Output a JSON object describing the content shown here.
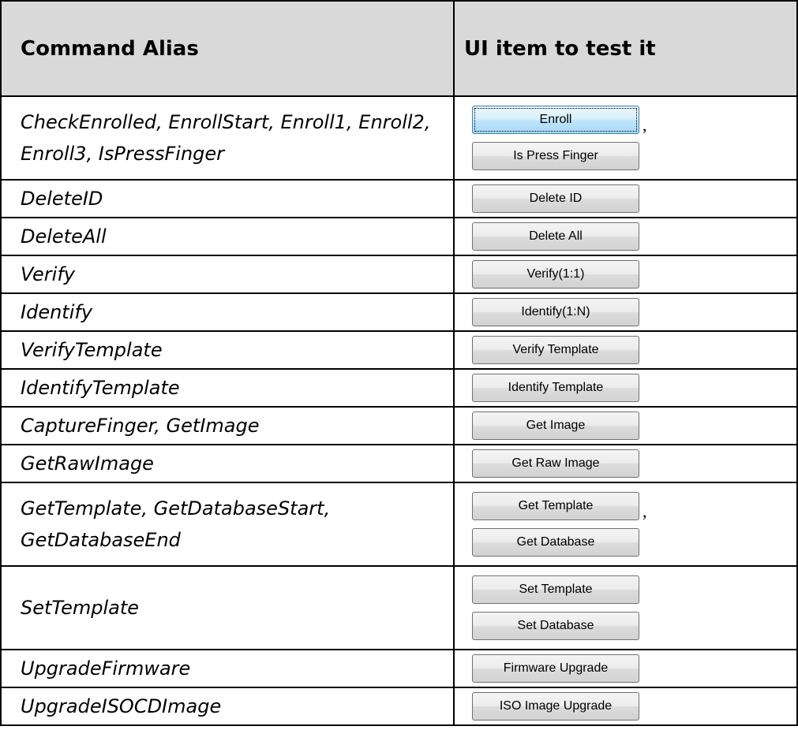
{
  "header": {
    "col1": "Command Alias",
    "col2": "UI item to test it"
  },
  "rows": [
    {
      "alias": "CheckEnrolled, EnrollStart, Enroll1, Enroll2, Enroll3, IsPressFinger",
      "buttons": [
        "Enroll",
        "Is Press Finger"
      ],
      "separator": ","
    },
    {
      "alias": "DeleteID",
      "buttons": [
        "Delete ID"
      ]
    },
    {
      "alias": "DeleteAll",
      "buttons": [
        "Delete All"
      ]
    },
    {
      "alias": "Verify",
      "buttons": [
        "Verify(1:1)"
      ]
    },
    {
      "alias": "Identify",
      "buttons": [
        "Identify(1:N)"
      ]
    },
    {
      "alias": "VerifyTemplate",
      "buttons": [
        "Verify Template"
      ]
    },
    {
      "alias": "IdentifyTemplate",
      "buttons": [
        "Identify Template"
      ]
    },
    {
      "alias": "CaptureFinger, GetImage",
      "buttons": [
        "Get Image"
      ]
    },
    {
      "alias": "GetRawImage",
      "buttons": [
        "Get Raw Image"
      ]
    },
    {
      "alias": "GetTemplate, GetDatabaseStart, GetDatabaseEnd",
      "buttons": [
        "Get Template",
        "Get Database"
      ],
      "separator": ","
    },
    {
      "alias": "SetTemplate",
      "buttons": [
        "Set Template",
        "Set Database"
      ]
    },
    {
      "alias": "UpgradeFirmware",
      "buttons": [
        "Firmware Upgrade"
      ]
    },
    {
      "alias": "UpgradeISOCDImage",
      "buttons": [
        "ISO Image Upgrade"
      ]
    }
  ]
}
